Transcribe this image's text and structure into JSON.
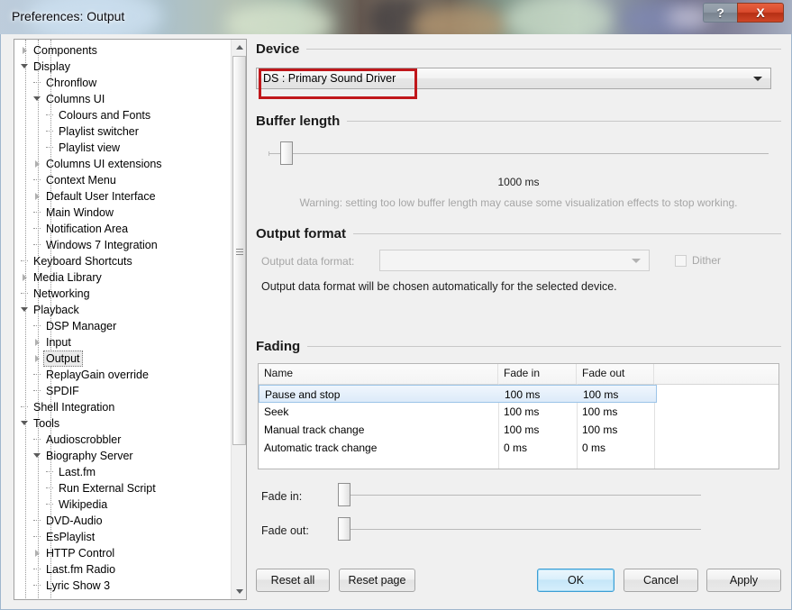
{
  "window": {
    "title": "Preferences: Output",
    "help_button": "?",
    "close_button": "X"
  },
  "tree": {
    "items": [
      {
        "label": "Components",
        "indent": 0,
        "marker": "collapsed",
        "selected": false
      },
      {
        "label": "Display",
        "indent": 0,
        "marker": "expanded",
        "selected": false
      },
      {
        "label": "Chronflow",
        "indent": 1,
        "marker": "leaf",
        "selected": false
      },
      {
        "label": "Columns UI",
        "indent": 1,
        "marker": "expanded",
        "selected": false
      },
      {
        "label": "Colours and Fonts",
        "indent": 2,
        "marker": "leaf",
        "selected": false
      },
      {
        "label": "Playlist switcher",
        "indent": 2,
        "marker": "leaf",
        "selected": false
      },
      {
        "label": "Playlist view",
        "indent": 2,
        "marker": "leaf",
        "selected": false
      },
      {
        "label": "Columns UI extensions",
        "indent": 1,
        "marker": "collapsed",
        "selected": false
      },
      {
        "label": "Context Menu",
        "indent": 1,
        "marker": "leaf",
        "selected": false
      },
      {
        "label": "Default User Interface",
        "indent": 1,
        "marker": "collapsed",
        "selected": false
      },
      {
        "label": "Main Window",
        "indent": 1,
        "marker": "leaf",
        "selected": false
      },
      {
        "label": "Notification Area",
        "indent": 1,
        "marker": "leaf",
        "selected": false
      },
      {
        "label": "Windows 7 Integration",
        "indent": 1,
        "marker": "leaf",
        "selected": false
      },
      {
        "label": "Keyboard Shortcuts",
        "indent": 0,
        "marker": "leaf",
        "selected": false
      },
      {
        "label": "Media Library",
        "indent": 0,
        "marker": "collapsed",
        "selected": false
      },
      {
        "label": "Networking",
        "indent": 0,
        "marker": "leaf",
        "selected": false
      },
      {
        "label": "Playback",
        "indent": 0,
        "marker": "expanded",
        "selected": false
      },
      {
        "label": "DSP Manager",
        "indent": 1,
        "marker": "leaf",
        "selected": false
      },
      {
        "label": "Input",
        "indent": 1,
        "marker": "collapsed",
        "selected": false
      },
      {
        "label": "Output",
        "indent": 1,
        "marker": "collapsed",
        "selected": true
      },
      {
        "label": "ReplayGain override",
        "indent": 1,
        "marker": "leaf",
        "selected": false
      },
      {
        "label": "SPDIF",
        "indent": 1,
        "marker": "leaf",
        "selected": false
      },
      {
        "label": "Shell Integration",
        "indent": 0,
        "marker": "leaf",
        "selected": false
      },
      {
        "label": "Tools",
        "indent": 0,
        "marker": "expanded",
        "selected": false
      },
      {
        "label": "Audioscrobbler",
        "indent": 1,
        "marker": "leaf",
        "selected": false
      },
      {
        "label": "Biography Server",
        "indent": 1,
        "marker": "expanded",
        "selected": false
      },
      {
        "label": "Last.fm",
        "indent": 2,
        "marker": "leaf",
        "selected": false
      },
      {
        "label": "Run External Script",
        "indent": 2,
        "marker": "leaf",
        "selected": false
      },
      {
        "label": "Wikipedia",
        "indent": 2,
        "marker": "leaf",
        "selected": false
      },
      {
        "label": "DVD-Audio",
        "indent": 1,
        "marker": "leaf",
        "selected": false
      },
      {
        "label": "EsPlaylist",
        "indent": 1,
        "marker": "leaf",
        "selected": false
      },
      {
        "label": "HTTP Control",
        "indent": 1,
        "marker": "collapsed",
        "selected": false
      },
      {
        "label": "Last.fm Radio",
        "indent": 1,
        "marker": "leaf",
        "selected": false
      },
      {
        "label": "Lyric Show 3",
        "indent": 1,
        "marker": "leaf",
        "selected": false
      }
    ]
  },
  "device": {
    "group_title": "Device",
    "selected": "DS : Primary Sound Driver",
    "annotation_color": "#c0171b"
  },
  "buffer": {
    "group_title": "Buffer length",
    "value_label": "1000 ms",
    "warning": "Warning: setting too low buffer length may cause some visualization effects to stop working."
  },
  "output_format": {
    "group_title": "Output format",
    "field_label": "Output data format:",
    "field_value": "",
    "dither_label": "Dither",
    "dither_checked": false,
    "note": "Output data format will be chosen automatically for the selected device."
  },
  "fading": {
    "group_title": "Fading",
    "columns": [
      "Name",
      "Fade in",
      "Fade out"
    ],
    "rows": [
      {
        "name": "Pause and stop",
        "fade_in": "100 ms",
        "fade_out": "100 ms",
        "selected": true
      },
      {
        "name": "Seek",
        "fade_in": "100 ms",
        "fade_out": "100 ms",
        "selected": false
      },
      {
        "name": "Manual track change",
        "fade_in": "100 ms",
        "fade_out": "100 ms",
        "selected": false
      },
      {
        "name": "Automatic track change",
        "fade_in": "0 ms",
        "fade_out": "0 ms",
        "selected": false
      }
    ],
    "fade_in_label": "Fade in:",
    "fade_out_label": "Fade out:"
  },
  "footer": {
    "reset_all": "Reset all",
    "reset_page": "Reset page",
    "ok": "OK",
    "cancel": "Cancel",
    "apply": "Apply"
  }
}
